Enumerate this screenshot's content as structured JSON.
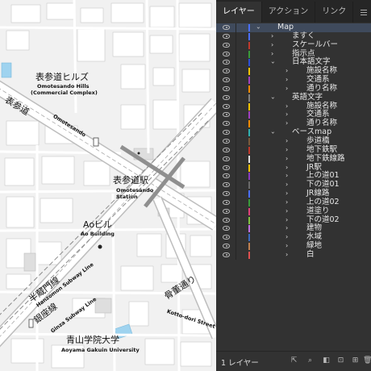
{
  "map": {
    "labels": {
      "omotesando_hills_jp": "表参道ヒルズ",
      "omotesando_hills_en1": "Omotesando Hills",
      "omotesando_hills_en2": "(Commercial Complex)",
      "omotesando_road_jp": "表参道",
      "omotesando_road_en": "Omotesando",
      "station_jp": "表参道駅",
      "station_en1": "Omotesando",
      "station_en2": "Station",
      "ao_jp": "Aoビル",
      "ao_en": "Ao Building",
      "hanzomon_jp": "半蔵門線",
      "hanzomon_en": "Hanzomon Subway Line",
      "ginza_jp": "銀座線",
      "ginza_en": "Ginza Subway Line",
      "kotto_jp": "骨董通り",
      "kotto_en": "Kotto-dori Street",
      "aoyama_jp": "青山学院大学",
      "aoyama_en": "Aoyama Gakuin University"
    }
  },
  "panel": {
    "tabs": [
      "レイヤー",
      "アクション",
      "リンク"
    ],
    "active_tab": "レイヤー",
    "layers": [
      {
        "name": "Map",
        "depth": 0,
        "open": true,
        "color": "#4a6fff",
        "selected": true
      },
      {
        "name": "ますく",
        "depth": 1,
        "open": false,
        "color": "#4a6fff"
      },
      {
        "name": "スケールバー",
        "depth": 1,
        "open": false,
        "color": "#c0392b"
      },
      {
        "name": "指示点",
        "depth": 1,
        "open": false,
        "color": "#3a9a3a"
      },
      {
        "name": "日本語文字",
        "depth": 1,
        "open": true,
        "color": "#2b4fd8"
      },
      {
        "name": "施設名称",
        "depth": 2,
        "open": false,
        "color": "#f2c200"
      },
      {
        "name": "交通系",
        "depth": 2,
        "open": false,
        "color": "#a040c0"
      },
      {
        "name": "通り名称",
        "depth": 2,
        "open": false,
        "color": "#f08a00"
      },
      {
        "name": "英語文字",
        "depth": 1,
        "open": true,
        "color": "#808080"
      },
      {
        "name": "施設名称",
        "depth": 2,
        "open": false,
        "color": "#f2c200"
      },
      {
        "name": "交通系",
        "depth": 2,
        "open": false,
        "color": "#a040c0"
      },
      {
        "name": "通り名称",
        "depth": 2,
        "open": false,
        "color": "#f08a00"
      },
      {
        "name": "ベースmap",
        "depth": 1,
        "open": true,
        "color": "#30b0b0"
      },
      {
        "name": "歩道橋",
        "depth": 2,
        "open": false,
        "color": "#7a5a3a"
      },
      {
        "name": "地下鉄駅",
        "depth": 2,
        "open": false,
        "color": "#c0392b"
      },
      {
        "name": "地下鉄線路",
        "depth": 2,
        "open": false,
        "color": "#e0e0e0"
      },
      {
        "name": "JR駅",
        "depth": 2,
        "open": false,
        "color": "#f2c200"
      },
      {
        "name": "上の道01",
        "depth": 2,
        "open": false,
        "color": "#8a3ac0"
      },
      {
        "name": "下の道01",
        "depth": 2,
        "open": false,
        "color": "#6a6a6a"
      },
      {
        "name": "JR線路",
        "depth": 2,
        "open": false,
        "color": "#4a6fff"
      },
      {
        "name": "上の道02",
        "depth": 2,
        "open": false,
        "color": "#3a9a3a"
      },
      {
        "name": "道塗り",
        "depth": 2,
        "open": false,
        "color": "#e0407a"
      },
      {
        "name": "下の道02",
        "depth": 2,
        "open": false,
        "color": "#80c040"
      },
      {
        "name": "建物",
        "depth": 2,
        "open": false,
        "color": "#c070e0"
      },
      {
        "name": "水域",
        "depth": 2,
        "open": false,
        "color": "#3a6ac0"
      },
      {
        "name": "緑地",
        "depth": 2,
        "open": false,
        "color": "#c08050"
      },
      {
        "name": "白",
        "depth": 2,
        "open": false,
        "color": "#e05050"
      }
    ],
    "footer_count": "1 レイヤー"
  }
}
